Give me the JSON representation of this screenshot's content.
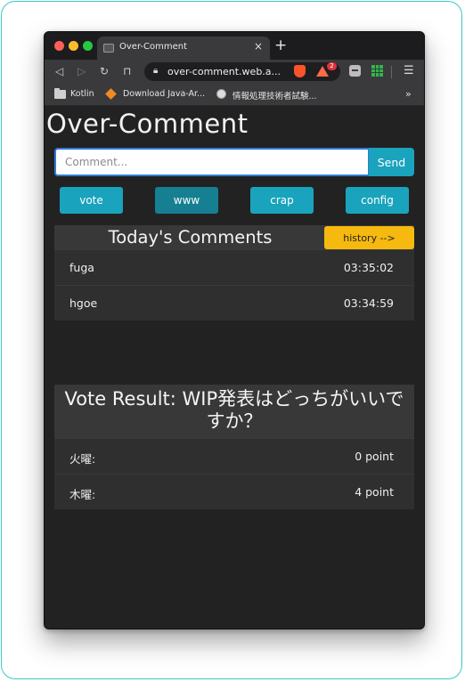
{
  "browser": {
    "tab_title": "Over-Comment",
    "tab_close": "×",
    "new_tab": "+",
    "url": "over-comment.web.a...",
    "ext_badge": "2",
    "bookmarks": [
      {
        "label": "Kotlin",
        "icon": "folder-icon"
      },
      {
        "label": "Download Java-Ar...",
        "icon": "diamond-icon"
      },
      {
        "label": "情報処理技術者試験...",
        "icon": "globe-icon"
      }
    ],
    "bookmarks_more": "»"
  },
  "app": {
    "title": "Over-Comment",
    "comment_placeholder": "Comment...",
    "send_label": "Send",
    "buttons": [
      "vote",
      "www",
      "crap",
      "config"
    ]
  },
  "today": {
    "title": "Today's Comments",
    "history_label": "history -->",
    "comments": [
      {
        "text": "fuga",
        "time": "03:35:02"
      },
      {
        "text": "hgoe",
        "time": "03:34:59"
      }
    ]
  },
  "vote": {
    "title": "Vote Result: WIP発表はどっちがいいですか？",
    "results": [
      {
        "option": "火曜:",
        "points": "0 point"
      },
      {
        "option": "木曜:",
        "points": "4 point"
      }
    ]
  },
  "colors": {
    "accent": "#1aa3bd",
    "accent_dark": "#177f92",
    "history": "#f5b90f",
    "page_bg": "#222222"
  }
}
